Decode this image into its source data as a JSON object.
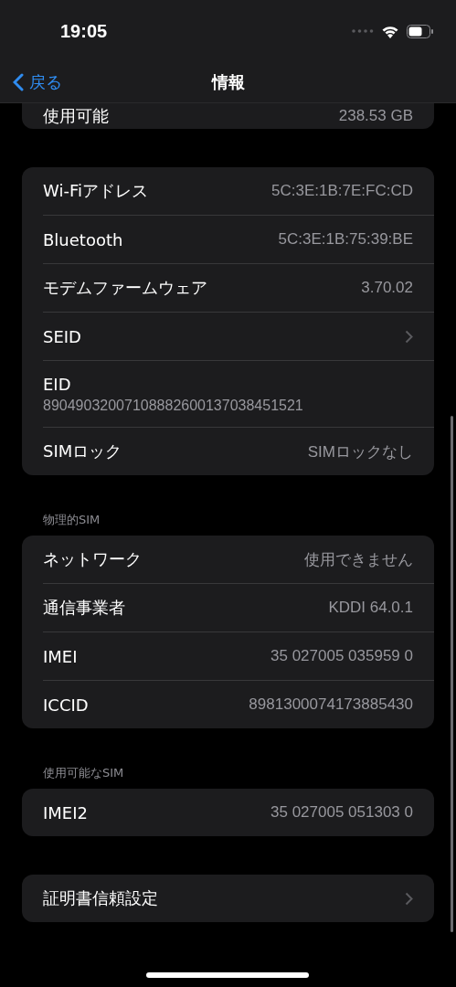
{
  "status_bar": {
    "time": "19:05"
  },
  "nav": {
    "back": "戻る",
    "title": "情報"
  },
  "sections": [
    {
      "rows": [
        {
          "kind": "value",
          "label": "使用可能",
          "value": "238.53 GB"
        }
      ]
    },
    {
      "rows": [
        {
          "kind": "value",
          "label": "Wi-Fiアドレス",
          "value": "5C:3E:1B:7E:FC:CD"
        },
        {
          "kind": "value",
          "label": "Bluetooth",
          "value": "5C:3E:1B:75:39:BE"
        },
        {
          "kind": "value",
          "label": "モデムファームウェア",
          "value": "3.70.02"
        },
        {
          "kind": "chevron",
          "label": "SEID"
        },
        {
          "kind": "stacked",
          "label": "EID",
          "value": "89049032007108882600137038451521"
        },
        {
          "kind": "value",
          "label": "SIMロック",
          "value": "SIMロックなし"
        }
      ]
    },
    {
      "header": "物理的SIM",
      "rows": [
        {
          "kind": "value",
          "label": "ネットワーク",
          "value": "使用できません"
        },
        {
          "kind": "value",
          "label": "通信事業者",
          "value": "KDDI 64.0.1"
        },
        {
          "kind": "value",
          "label": "IMEI",
          "value": "35 027005 035959 0"
        },
        {
          "kind": "value",
          "label": "ICCID",
          "value": "8981300074173885430"
        }
      ]
    },
    {
      "header": "使用可能なSIM",
      "rows": [
        {
          "kind": "value",
          "label": "IMEI2",
          "value": "35 027005 051303 0"
        }
      ]
    },
    {
      "rows": [
        {
          "kind": "chevron",
          "label": "証明書信頼設定"
        }
      ]
    }
  ]
}
